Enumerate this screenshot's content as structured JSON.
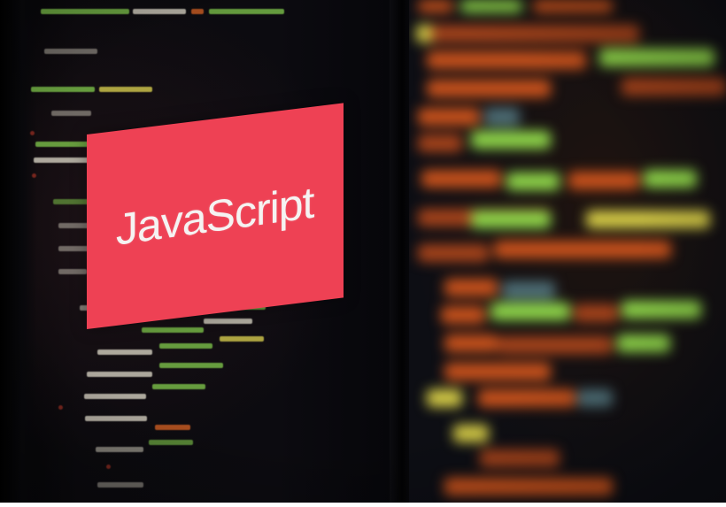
{
  "image": {
    "label_text": "JavaScript",
    "label_color": "#ee4154",
    "background_color": "#050508",
    "code_colors": {
      "orange": "#c9521c",
      "green": "#8fd64a",
      "yellow": "#d6cc47",
      "white": "#c9c4b6"
    }
  }
}
